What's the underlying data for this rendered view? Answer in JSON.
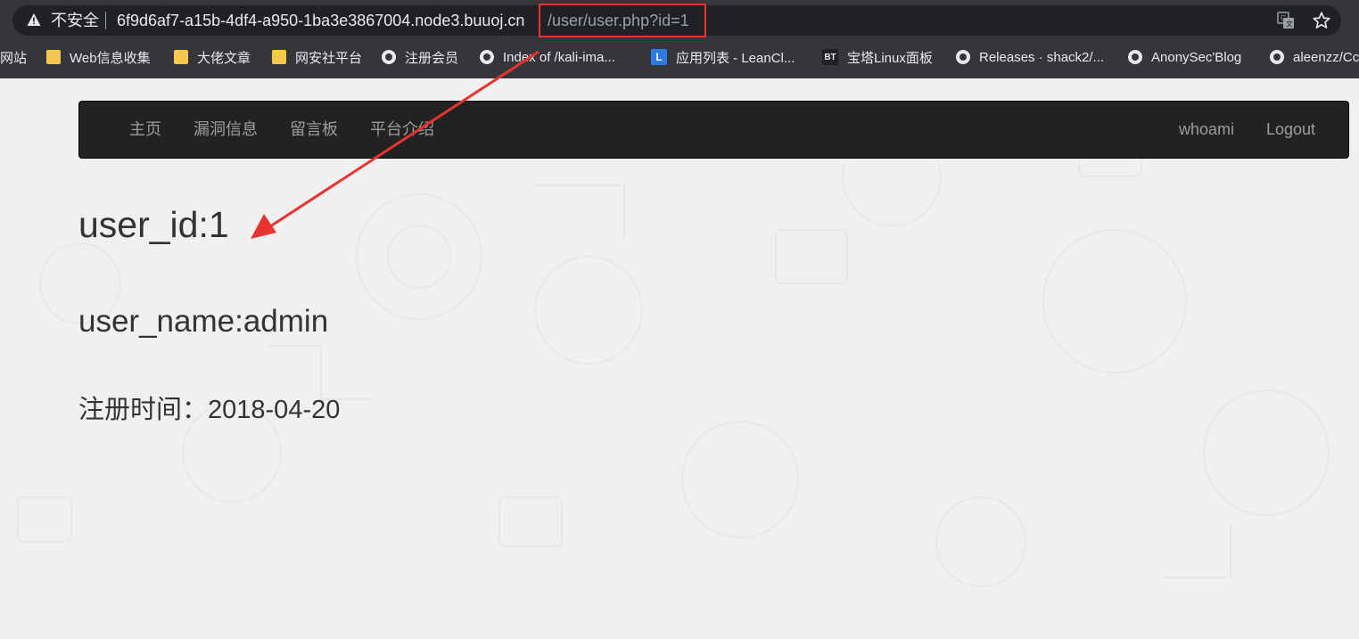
{
  "browser": {
    "security_label": "不安全",
    "url_host": "6f9d6af7-a15b-4df4-a950-1ba3e3867004.node3.buuoj.cn",
    "url_path": "/user/user.php?id=1",
    "icons": [
      "warning-icon",
      "translate-icon",
      "star-icon"
    ]
  },
  "bookmarks": [
    {
      "label": "网站",
      "icon": "none"
    },
    {
      "label": "Web信息收集",
      "icon": "folder-icon"
    },
    {
      "label": "大佬文章",
      "icon": "folder-icon"
    },
    {
      "label": "网安社平台",
      "icon": "folder-icon"
    },
    {
      "label": "注册会员",
      "icon": "globe-icon"
    },
    {
      "label": "Index of /kali-ima...",
      "icon": "globe-icon"
    },
    {
      "label": "应用列表 - LeanCl...",
      "icon": "leancloud-icon",
      "icon_text": "L"
    },
    {
      "label": "宝塔Linux面板",
      "icon": "baota-icon",
      "icon_text": "BT"
    },
    {
      "label": "Releases · shack2/...",
      "icon": "globe-icon"
    },
    {
      "label": "AnonySec'Blog",
      "icon": "globe-icon"
    },
    {
      "label": "aleenzz/Cc",
      "icon": "globe-icon"
    }
  ],
  "navbar": {
    "left": [
      "主页",
      "漏洞信息",
      "留言板",
      "平台介绍"
    ],
    "right": [
      "whoami",
      "Logout"
    ]
  },
  "profile": {
    "user_id": "user_id:1",
    "user_name": "user_name:admin",
    "reg_label": "注册时间：",
    "reg_value": "2018-04-20"
  },
  "colors": {
    "chrome_bg": "#35363a",
    "omnibox_bg": "#202124",
    "navbar_bg": "#222222",
    "nav_text": "#9d9d9d",
    "annotation_red": "#e8332f",
    "page_bg": "#f0f0f0"
  }
}
